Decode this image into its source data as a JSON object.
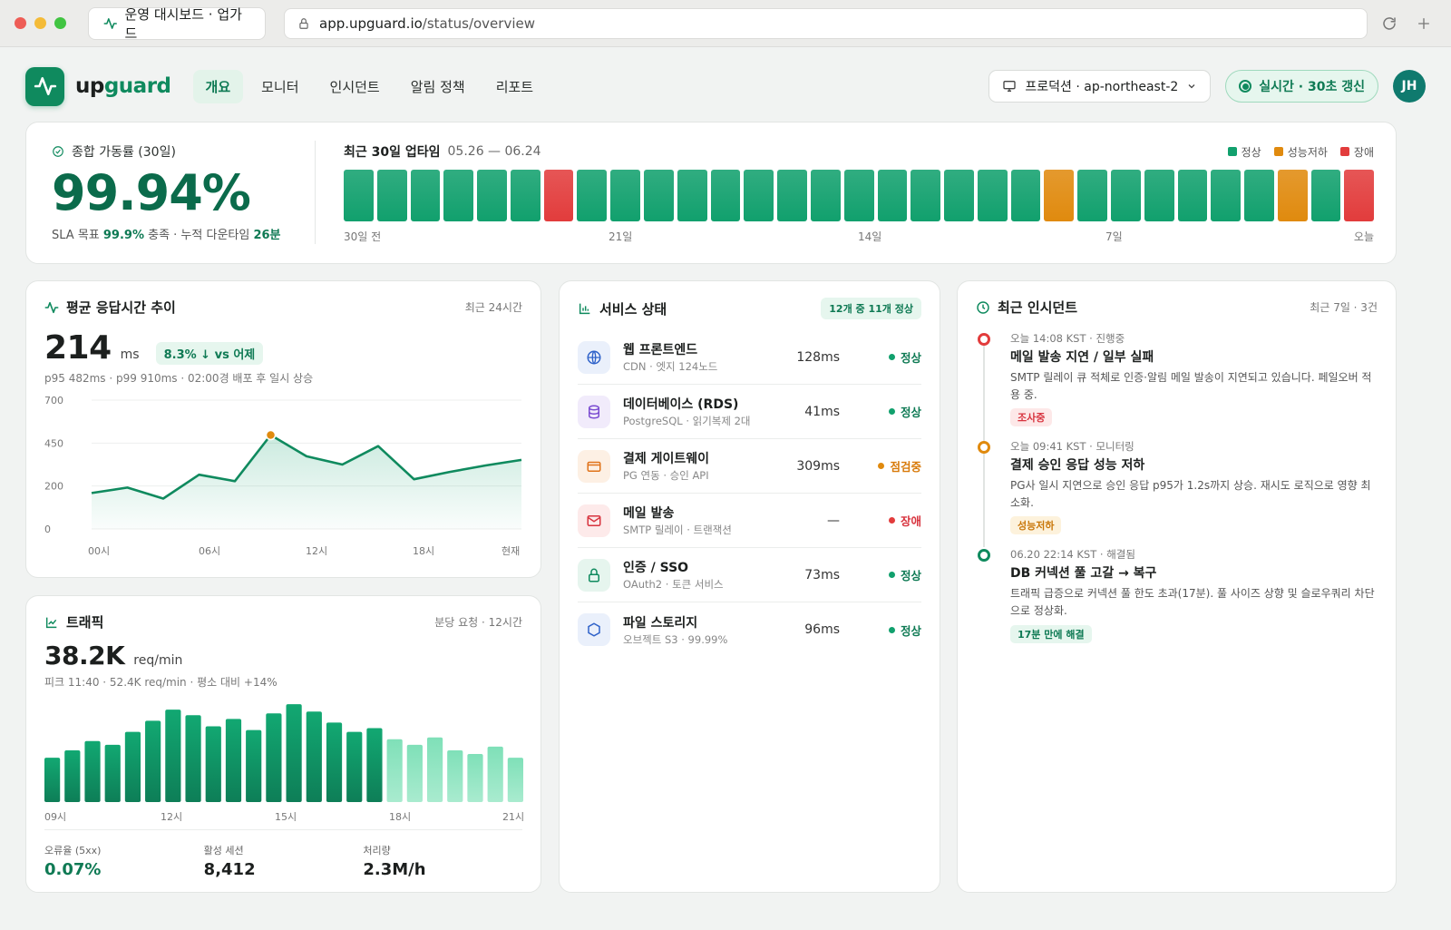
{
  "browser": {
    "tab_title": "운영 대시보드 · 업가드",
    "url_domain": "app.upguard.io",
    "url_path": "/status/overview"
  },
  "app": {
    "brand_part1": "up",
    "brand_part2": "guard",
    "nav": [
      "개요",
      "모니터",
      "인시던트",
      "알림 정책",
      "리포트"
    ],
    "env_label": "프로덕션 · ap-northeast-2",
    "live_label": "실시간 · 30초 갱신",
    "avatar_initials": "JH"
  },
  "availability": {
    "label": "종합 가동률 (30일)",
    "value": "99.94%",
    "sla_prefix": "SLA 목표 ",
    "sla_target": "99.9%",
    "sla_middle": " 충족 · 누적 다운타임 ",
    "downtime": "26분"
  },
  "uptime": {
    "title": "최근 30일 업타임",
    "range": "05.26 — 06.24",
    "legend": [
      "정상",
      "성능저하",
      "장애"
    ],
    "ticks": [
      "30일 전",
      "21일",
      "14일",
      "7일",
      "오늘"
    ],
    "days": [
      "ok",
      "ok",
      "ok",
      "ok",
      "ok",
      "ok",
      "down",
      "ok",
      "ok",
      "ok",
      "ok",
      "ok",
      "ok",
      "ok",
      "ok",
      "ok",
      "ok",
      "ok",
      "ok",
      "ok",
      "ok",
      "degraded",
      "ok",
      "ok",
      "ok",
      "ok",
      "ok",
      "ok",
      "degraded",
      "ok",
      "down"
    ]
  },
  "colors": {
    "ok": "#11a06d",
    "degraded": "#e08a0e",
    "down": "#e23c3c",
    "accent": "#0f8a5e"
  },
  "response": {
    "title": "평균 응답시간 추이",
    "subtitle": "최근 24시간",
    "value": "214",
    "unit": "ms",
    "change": "8.3% ↓ vs 어제",
    "note": "p95 482ms · p99 910ms · 02:00경 배포 후 일시 상승"
  },
  "traffic": {
    "title": "트래픽",
    "subtitle": "분당 요청 · 12시간",
    "value": "38.2K",
    "unit": "req/min",
    "note": "피크 11:40 · 52.4K req/min · 평소 대비 +14%",
    "kpis": [
      {
        "label": "오류율 (5xx)",
        "value": "0.07%"
      },
      {
        "label": "활성 세션",
        "value": "8,412"
      },
      {
        "label": "처리량",
        "value": "2.3M/h"
      }
    ]
  },
  "chart_data": [
    {
      "type": "line",
      "x": [
        "00시",
        "",
        "",
        "06시",
        "",
        "12시",
        "",
        "",
        "18시",
        "",
        "",
        "현재"
      ],
      "tick_labels": [
        "00시",
        "06시",
        "12시",
        "18시",
        "현재"
      ],
      "y_ticks": [
        "700",
        "450",
        "200",
        "0"
      ],
      "ylim": [
        0,
        700
      ],
      "values": [
        195,
        225,
        165,
        295,
        260,
        510,
        395,
        350,
        450,
        270,
        310,
        345,
        375
      ],
      "highlight_index": 5
    },
    {
      "type": "bar",
      "tick_labels": [
        "09시",
        "12시",
        "15시",
        "18시",
        "21시"
      ],
      "values": [
        24,
        28,
        33,
        31,
        38,
        44,
        50,
        47,
        41,
        45,
        39,
        48,
        53,
        49,
        43,
        38,
        40,
        34,
        31,
        35,
        28,
        26,
        30,
        24
      ],
      "highlight_from": 17
    }
  ],
  "services": {
    "title": "서비스 상태",
    "count": "12개 중 11개 정상",
    "items": [
      {
        "name": "웹 프론트엔드",
        "desc": "CDN · 엣지 124노드",
        "latency": "128ms",
        "status": "정상",
        "state": "ok",
        "icon": "globe"
      },
      {
        "name": "데이터베이스 (RDS)",
        "desc": "PostgreSQL · 읽기복제 2대",
        "latency": "41ms",
        "status": "정상",
        "state": "ok",
        "icon": "database"
      },
      {
        "name": "결제 게이트웨이",
        "desc": "PG 연동 · 승인 API",
        "latency": "309ms",
        "status": "점검중",
        "state": "degraded",
        "icon": "card"
      },
      {
        "name": "메일 발송",
        "desc": "SMTP 릴레이 · 트랜잭션",
        "latency": "—",
        "status": "장애",
        "state": "down",
        "icon": "mail"
      },
      {
        "name": "인증 / SSO",
        "desc": "OAuth2 · 토큰 서비스",
        "latency": "73ms",
        "status": "정상",
        "state": "ok",
        "icon": "lock"
      },
      {
        "name": "파일 스토리지",
        "desc": "오브젝트 S3 · 99.99%",
        "latency": "96ms",
        "status": "정상",
        "state": "ok",
        "icon": "hexagon"
      }
    ]
  },
  "incidents": {
    "title": "최근 인시던트",
    "subtitle": "최근 7일 · 3건",
    "items": [
      {
        "meta": "오늘 14:08 KST · 진행중",
        "title": "메일 발송 지연 / 일부 실패",
        "desc": "SMTP 릴레이 큐 적체로 인증·알림 메일 발송이 지연되고 있습니다. 페일오버 적용 중.",
        "tag": "조사중",
        "state": "down"
      },
      {
        "meta": "오늘 09:41 KST · 모니터링",
        "title": "결제 승인 응답 성능 저하",
        "desc": "PG사 일시 지연으로 승인 응답 p95가 1.2s까지 상승. 재시도 로직으로 영향 최소화.",
        "tag": "성능저하",
        "state": "degraded"
      },
      {
        "meta": "06.20 22:14 KST · 해결됨",
        "title": "DB 커넥션 풀 고갈 → 복구",
        "desc": "트래픽 급증으로 커넥션 풀 한도 초과(17분). 풀 사이즈 상향 및 슬로우쿼리 차단으로 정상화.",
        "tag": "17분 만에 해결",
        "state": "ok"
      }
    ]
  }
}
